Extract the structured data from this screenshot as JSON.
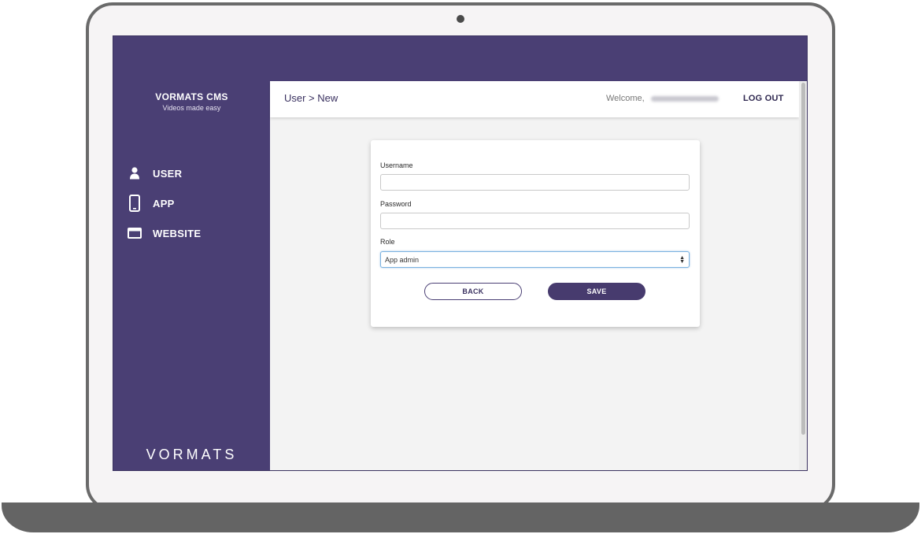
{
  "sidebar": {
    "brand_title": "VORMATS CMS",
    "brand_subtitle": "Videos made easy",
    "items": [
      {
        "label": "USER",
        "icon": "user-icon"
      },
      {
        "label": "APP",
        "icon": "phone-icon"
      },
      {
        "label": "WEBSITE",
        "icon": "browser-window-icon"
      }
    ],
    "logo_text": "VORMATS"
  },
  "header": {
    "breadcrumb": "User > New",
    "welcome_label": "Welcome,",
    "logout_label": "LOG OUT"
  },
  "form": {
    "username_label": "Username",
    "username_value": "",
    "password_label": "Password",
    "password_value": "",
    "role_label": "Role",
    "role_value": "App admin",
    "back_label": "BACK",
    "save_label": "SAVE"
  },
  "colors": {
    "brand_purple": "#4a3f74",
    "content_bg": "#f3f3f3",
    "focus_blue": "#7bb3e0"
  }
}
